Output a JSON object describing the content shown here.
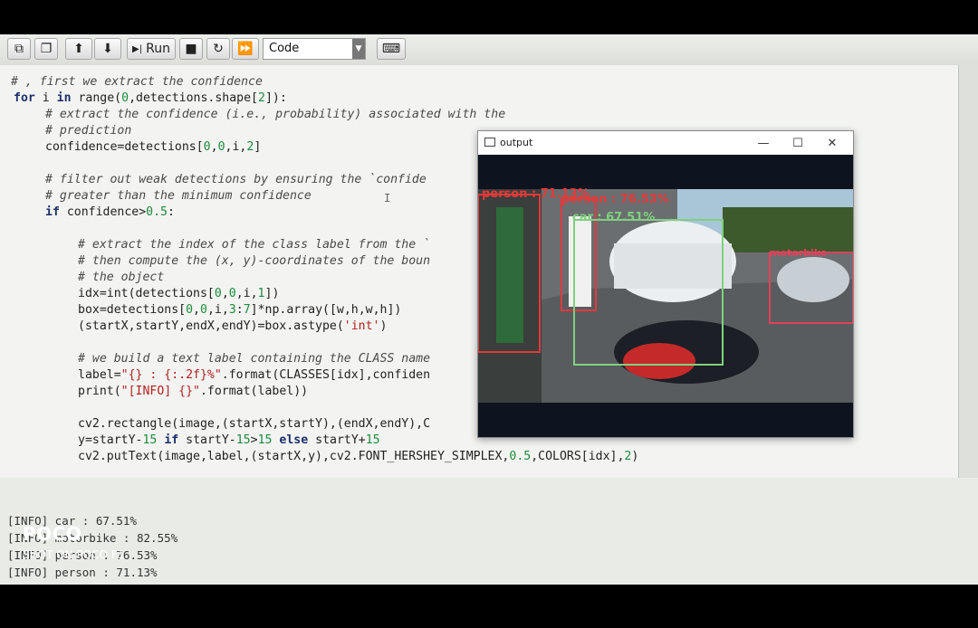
{
  "toolbar": {
    "run_label": "Run",
    "cell_type": "Code"
  },
  "code": {
    "lines": [
      "# , first we extract the confidence",
      "for",
      " i ",
      "in",
      " range(",
      "0",
      ",detections.shape[",
      "2",
      "]):",
      "# extract the confidence (i.e., probability) associated with the",
      "# prediction",
      "confidence=detections[",
      "0",
      ",",
      "0",
      ",i,",
      "2",
      "]",
      "# filter out weak detections by ensuring the `confide",
      "# greater than the minimum confidence",
      "if",
      " confidence>",
      "0.5",
      ":",
      "# extract the index of the class label from the `",
      "# then compute the (x, y)-coordinates of the boun",
      "# the object",
      "idx=int(detections[",
      "0",
      ",",
      "0",
      ",i,",
      "1",
      "])",
      "box=detections[",
      "0",
      ",",
      "0",
      ",i,",
      "3",
      ":",
      "7",
      "]*np.array([w,h,w,h])",
      "(startX,startY,endX,endY)=box.astype(",
      "'int'",
      ")",
      "# we build a text label containing the CLASS name",
      "label=",
      "\"{} : {:.2f}%\"",
      ".format(CLASSES[idx],confiden",
      "print(",
      "\"[INFO] {}\"",
      ".format(label))",
      "cv2.rectangle(image,(startX,startY),(endX,endY),C",
      "y=startY-",
      "15",
      "if",
      " startY-",
      "15",
      ">",
      "15",
      "else",
      " startY+",
      "15",
      "cv2.putText(image,label,(startX,y),cv2.FONT_HERSHEY_SIMPLEX,",
      "0.5",
      ",COLORS[idx],",
      "2",
      ")"
    ]
  },
  "output": {
    "lines": [
      "[INFO] car : 67.51%",
      "[INFO] motorbike : 82.55%",
      "[INFO] person : 76.53%",
      "[INFO] person : 71.13%"
    ]
  },
  "window": {
    "title": "output",
    "minimize": "—",
    "maximize": "☐",
    "close": "✕"
  },
  "detections": {
    "person1": "person : 71.13%",
    "person2": "person : 76.53%",
    "car": "car : 67.51%",
    "motorbike": "motorbike"
  },
  "watermark": {
    "brand": "POCO",
    "model": "SHOT ON POCO F1"
  },
  "colors": {
    "person": "#e23a3a",
    "car": "#7fd07f",
    "motorbike": "#e2405a"
  }
}
